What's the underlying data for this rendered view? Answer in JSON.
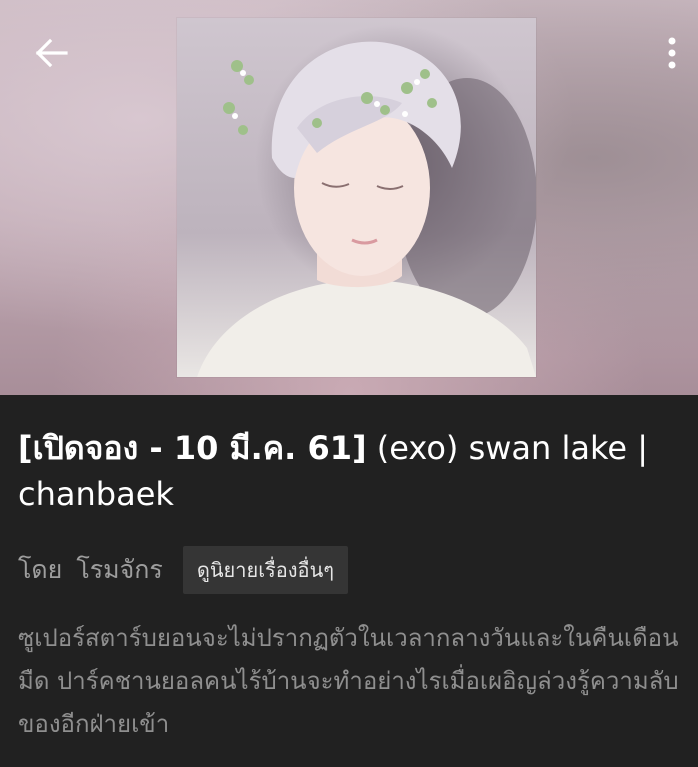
{
  "header": {
    "back_icon": "arrow-left-icon",
    "menu_icon": "more-vert-icon",
    "cover_image": "book-cover-portrait",
    "background_color": "#c4afb8"
  },
  "story": {
    "title_tag": "[เปิดจอง - 10 มี.ค. 61]",
    "title_rest": " (exo) swan lake | chanbaek",
    "author_prefix": "โดย",
    "author_name": "โรมจักร",
    "more_stories_label": "ดูนิยายเรื่องอื่นๆ",
    "synopsis": "ซูเปอร์สตาร์บยอนจะไม่ปรากฏตัวในเวลากลางวันและในคืนเดือนมืด ปาร์คชานยอลคนไร้บ้านจะทำอย่างไรเมื่อเผอิญล่วงรู้ความลับของอีกฝ่ายเข้า"
  },
  "colors": {
    "page_background": "#212121",
    "title_text": "#ffffff",
    "secondary_text": "#9e9e9e",
    "chip_background": "#353535"
  }
}
